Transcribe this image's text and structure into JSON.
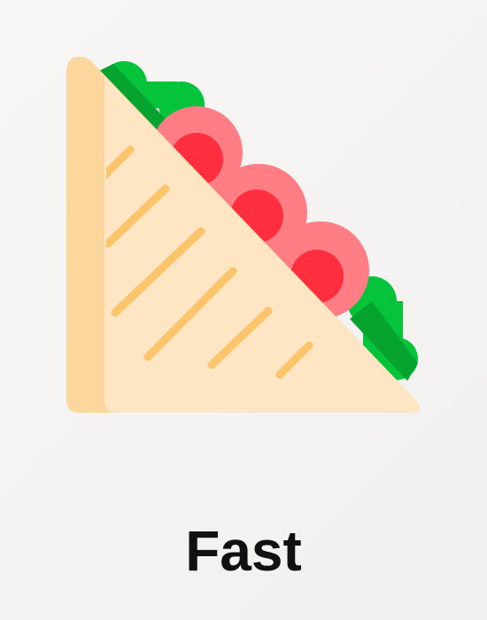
{
  "caption": {
    "text": "Fast"
  },
  "illustration": {
    "icon": "sandwich-icon",
    "colors": {
      "bread_dark": "#fbd69d",
      "bread_light": "#fee6c4",
      "grill_marks": "#fcc46b",
      "lettuce": "#05c43c",
      "lettuce_dark": "#06a32f",
      "tomato": "#ff7e86",
      "tomato_dark": "#ff2f3f"
    }
  }
}
